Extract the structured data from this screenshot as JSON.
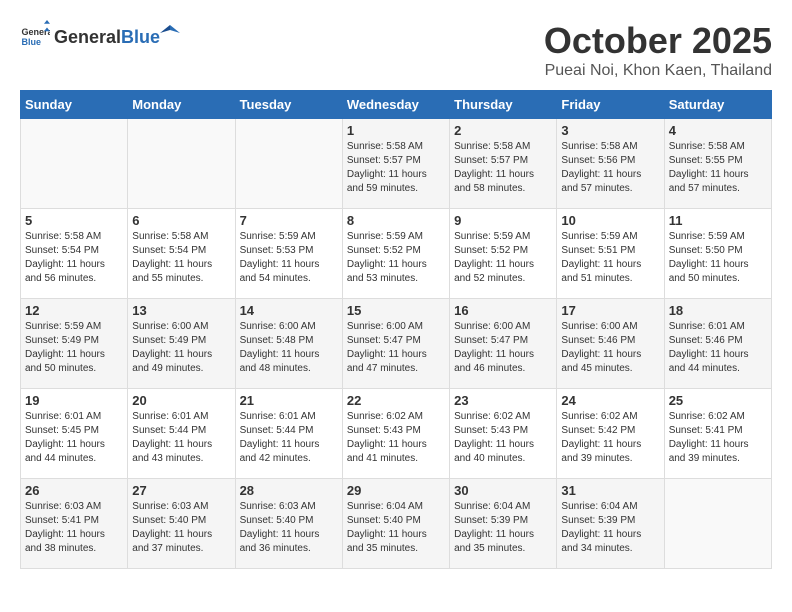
{
  "header": {
    "logo_general": "General",
    "logo_blue": "Blue",
    "month": "October 2025",
    "location": "Pueai Noi, Khon Kaen, Thailand"
  },
  "weekdays": [
    "Sunday",
    "Monday",
    "Tuesday",
    "Wednesday",
    "Thursday",
    "Friday",
    "Saturday"
  ],
  "weeks": [
    [
      {
        "day": "",
        "sunrise": "",
        "sunset": "",
        "daylight": ""
      },
      {
        "day": "",
        "sunrise": "",
        "sunset": "",
        "daylight": ""
      },
      {
        "day": "",
        "sunrise": "",
        "sunset": "",
        "daylight": ""
      },
      {
        "day": "1",
        "sunrise": "5:58 AM",
        "sunset": "5:57 PM",
        "daylight": "11 hours and 59 minutes."
      },
      {
        "day": "2",
        "sunrise": "5:58 AM",
        "sunset": "5:57 PM",
        "daylight": "11 hours and 58 minutes."
      },
      {
        "day": "3",
        "sunrise": "5:58 AM",
        "sunset": "5:56 PM",
        "daylight": "11 hours and 57 minutes."
      },
      {
        "day": "4",
        "sunrise": "5:58 AM",
        "sunset": "5:55 PM",
        "daylight": "11 hours and 57 minutes."
      }
    ],
    [
      {
        "day": "5",
        "sunrise": "5:58 AM",
        "sunset": "5:54 PM",
        "daylight": "11 hours and 56 minutes."
      },
      {
        "day": "6",
        "sunrise": "5:58 AM",
        "sunset": "5:54 PM",
        "daylight": "11 hours and 55 minutes."
      },
      {
        "day": "7",
        "sunrise": "5:59 AM",
        "sunset": "5:53 PM",
        "daylight": "11 hours and 54 minutes."
      },
      {
        "day": "8",
        "sunrise": "5:59 AM",
        "sunset": "5:52 PM",
        "daylight": "11 hours and 53 minutes."
      },
      {
        "day": "9",
        "sunrise": "5:59 AM",
        "sunset": "5:52 PM",
        "daylight": "11 hours and 52 minutes."
      },
      {
        "day": "10",
        "sunrise": "5:59 AM",
        "sunset": "5:51 PM",
        "daylight": "11 hours and 51 minutes."
      },
      {
        "day": "11",
        "sunrise": "5:59 AM",
        "sunset": "5:50 PM",
        "daylight": "11 hours and 50 minutes."
      }
    ],
    [
      {
        "day": "12",
        "sunrise": "5:59 AM",
        "sunset": "5:49 PM",
        "daylight": "11 hours and 50 minutes."
      },
      {
        "day": "13",
        "sunrise": "6:00 AM",
        "sunset": "5:49 PM",
        "daylight": "11 hours and 49 minutes."
      },
      {
        "day": "14",
        "sunrise": "6:00 AM",
        "sunset": "5:48 PM",
        "daylight": "11 hours and 48 minutes."
      },
      {
        "day": "15",
        "sunrise": "6:00 AM",
        "sunset": "5:47 PM",
        "daylight": "11 hours and 47 minutes."
      },
      {
        "day": "16",
        "sunrise": "6:00 AM",
        "sunset": "5:47 PM",
        "daylight": "11 hours and 46 minutes."
      },
      {
        "day": "17",
        "sunrise": "6:00 AM",
        "sunset": "5:46 PM",
        "daylight": "11 hours and 45 minutes."
      },
      {
        "day": "18",
        "sunrise": "6:01 AM",
        "sunset": "5:46 PM",
        "daylight": "11 hours and 44 minutes."
      }
    ],
    [
      {
        "day": "19",
        "sunrise": "6:01 AM",
        "sunset": "5:45 PM",
        "daylight": "11 hours and 44 minutes."
      },
      {
        "day": "20",
        "sunrise": "6:01 AM",
        "sunset": "5:44 PM",
        "daylight": "11 hours and 43 minutes."
      },
      {
        "day": "21",
        "sunrise": "6:01 AM",
        "sunset": "5:44 PM",
        "daylight": "11 hours and 42 minutes."
      },
      {
        "day": "22",
        "sunrise": "6:02 AM",
        "sunset": "5:43 PM",
        "daylight": "11 hours and 41 minutes."
      },
      {
        "day": "23",
        "sunrise": "6:02 AM",
        "sunset": "5:43 PM",
        "daylight": "11 hours and 40 minutes."
      },
      {
        "day": "24",
        "sunrise": "6:02 AM",
        "sunset": "5:42 PM",
        "daylight": "11 hours and 39 minutes."
      },
      {
        "day": "25",
        "sunrise": "6:02 AM",
        "sunset": "5:41 PM",
        "daylight": "11 hours and 39 minutes."
      }
    ],
    [
      {
        "day": "26",
        "sunrise": "6:03 AM",
        "sunset": "5:41 PM",
        "daylight": "11 hours and 38 minutes."
      },
      {
        "day": "27",
        "sunrise": "6:03 AM",
        "sunset": "5:40 PM",
        "daylight": "11 hours and 37 minutes."
      },
      {
        "day": "28",
        "sunrise": "6:03 AM",
        "sunset": "5:40 PM",
        "daylight": "11 hours and 36 minutes."
      },
      {
        "day": "29",
        "sunrise": "6:04 AM",
        "sunset": "5:40 PM",
        "daylight": "11 hours and 35 minutes."
      },
      {
        "day": "30",
        "sunrise": "6:04 AM",
        "sunset": "5:39 PM",
        "daylight": "11 hours and 35 minutes."
      },
      {
        "day": "31",
        "sunrise": "6:04 AM",
        "sunset": "5:39 PM",
        "daylight": "11 hours and 34 minutes."
      },
      {
        "day": "",
        "sunrise": "",
        "sunset": "",
        "daylight": ""
      }
    ]
  ]
}
